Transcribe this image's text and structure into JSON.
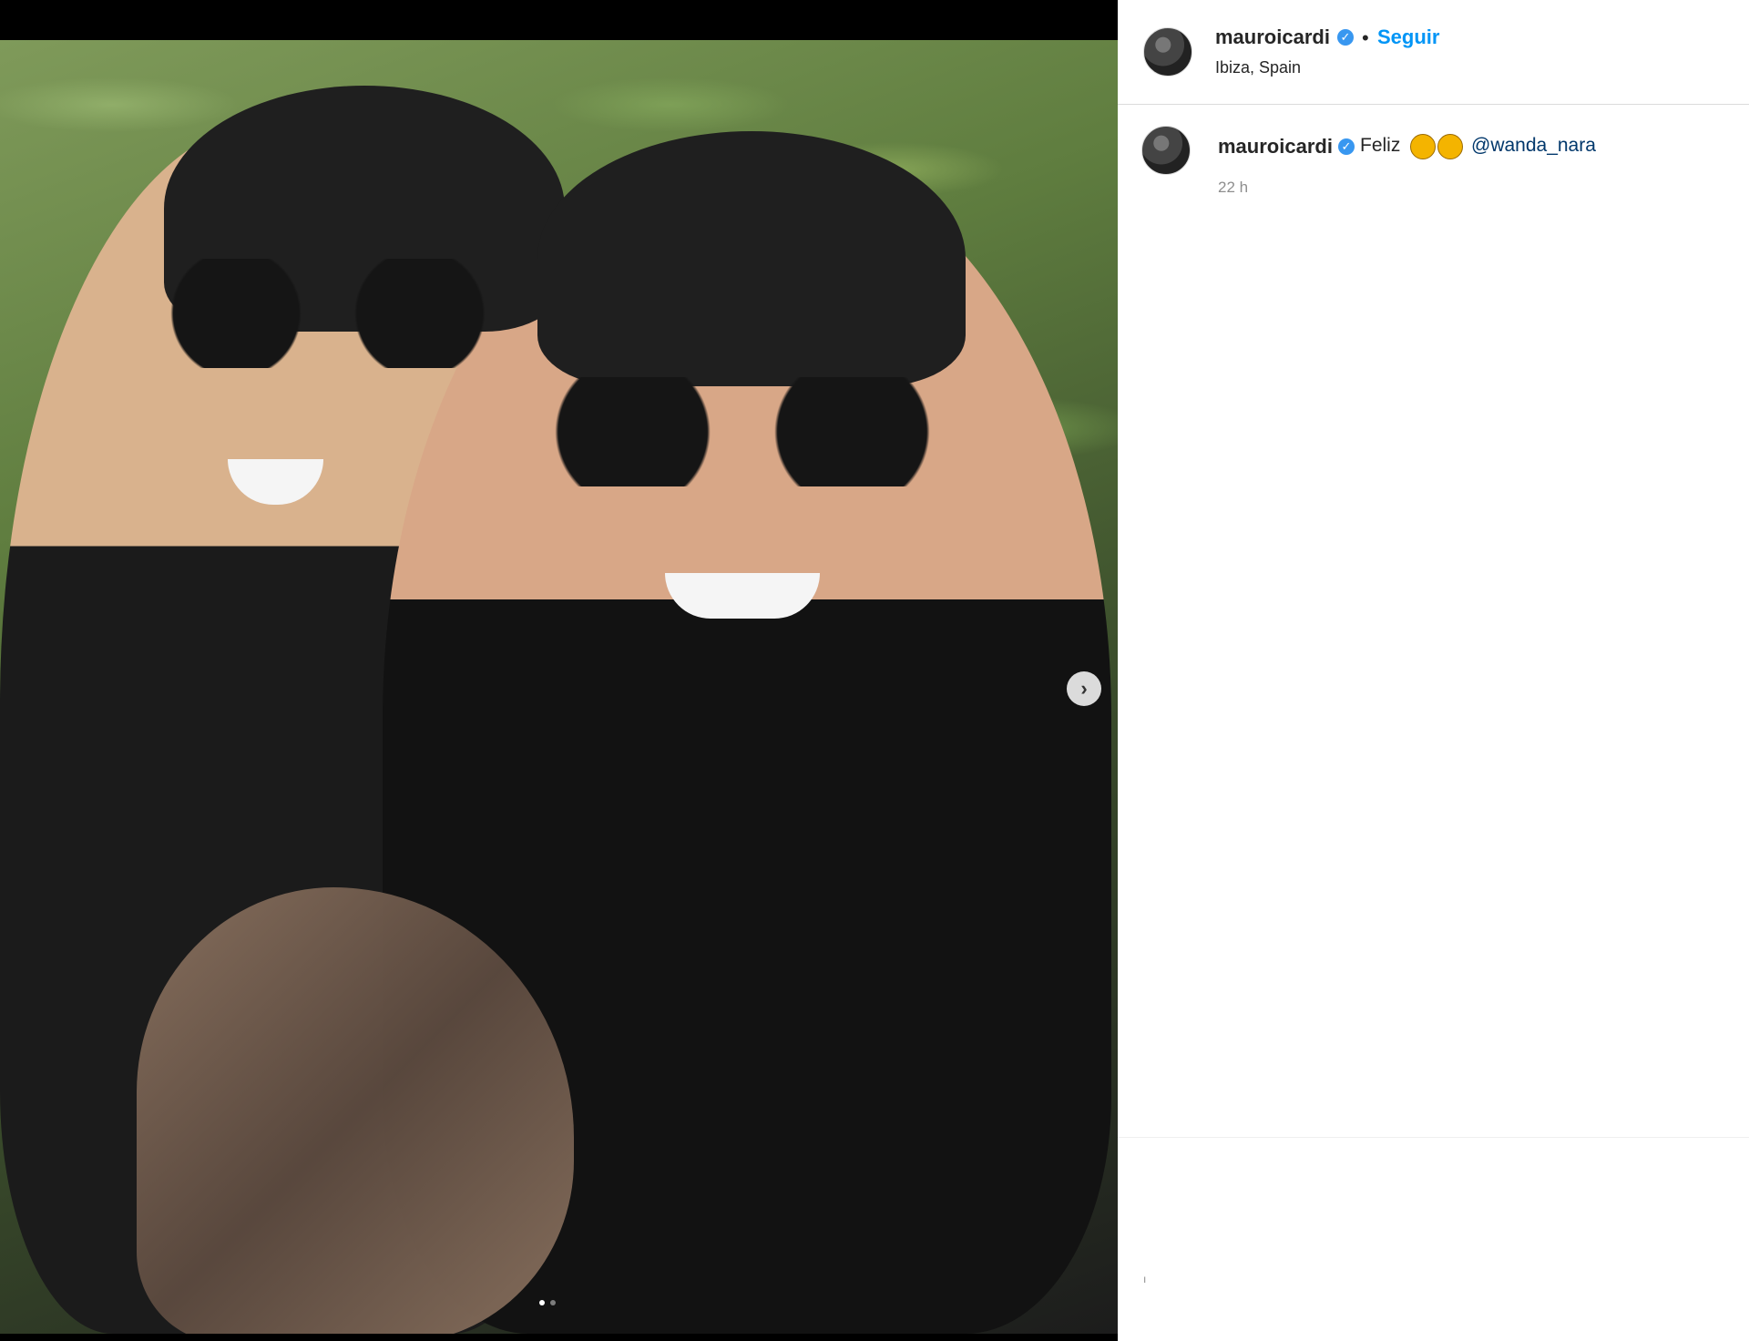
{
  "post": {
    "media": {
      "next_icon": "chevron-right-icon"
    },
    "header": {
      "username": "mauroicardi",
      "separator": "•",
      "follow_label": "Seguir",
      "location": "Ibiza, Spain",
      "verified_icon": "verified-badge-icon"
    },
    "caption": {
      "username": "mauroicardi",
      "text": "Feliz",
      "emoji_1": "grinning-face-icon",
      "emoji_2": "winking-tongue-face-icon",
      "mention": "@wanda_nara",
      "time": "22 h"
    },
    "footer": {
      "mark": "ı"
    }
  }
}
